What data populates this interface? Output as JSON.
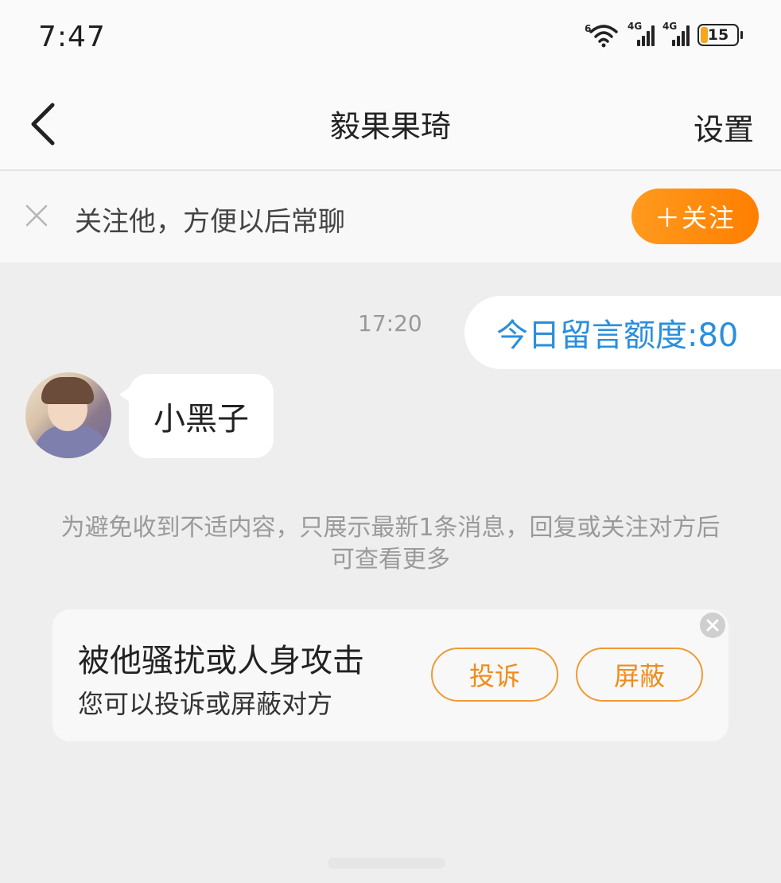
{
  "status_bar": {
    "time": "7:47",
    "network_a": "4G",
    "network_b": "4G",
    "battery_level": "15",
    "icons": [
      "wifi-icon",
      "signal-icon",
      "signal-icon",
      "battery-icon"
    ]
  },
  "header": {
    "title": "毅果果琦",
    "settings_label": "设置",
    "back_icon": "chevron-left-icon"
  },
  "follow_bar": {
    "text": "关注他，方便以后常聊",
    "button_label": "＋关注",
    "close_icon": "close-icon",
    "accent_color": "#ff8a00"
  },
  "chat": {
    "timestamp": "17:20",
    "messages": [
      {
        "side": "right",
        "text": "今日留言额度:80",
        "color": "#2a8fdd"
      },
      {
        "side": "left",
        "text": "小黑子"
      }
    ]
  },
  "notice": {
    "text": "为避免收到不适内容，只展示最新1条消息，回复或关注对方后可查看更多"
  },
  "harassment_card": {
    "title": "被他骚扰或人身攻击",
    "subtitle": "您可以投诉或屏蔽对方",
    "report_label": "投诉",
    "block_label": "屏蔽",
    "accent_color": "#f08c1a"
  }
}
